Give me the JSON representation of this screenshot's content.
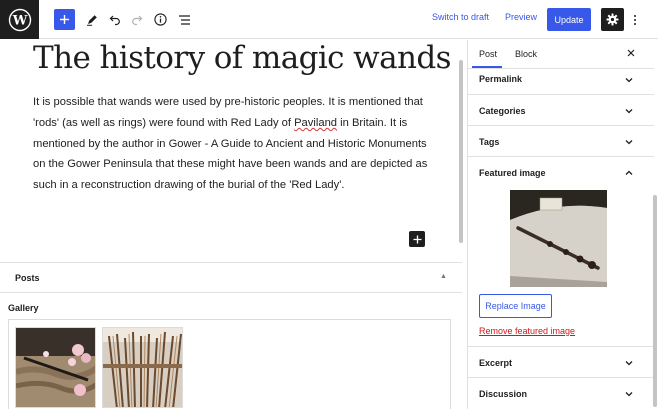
{
  "toolbar": {
    "switch_to_draft": "Switch to draft",
    "preview": "Preview",
    "update": "Update",
    "icons": [
      "wordpress-logo-icon",
      "plus-icon",
      "pencil-icon",
      "undo-icon",
      "redo-icon",
      "info-icon",
      "list-view-icon",
      "gear-icon",
      "more-vertical-icon"
    ],
    "accent": "#3858e9"
  },
  "editor": {
    "title": "The history of magic wands",
    "paragraph": {
      "part1": "It is possible that wands were used by pre-historic peoples. It is mentioned that 'rods' (as well as rings) were found with Red Lady of ",
      "squiggle": "Paviland",
      "part2": " in Britain. It is mentioned by the author in Gower - A Guide to Ancient and Historic Monuments on the Gower Peninsula that these might have been wands and are depicted as such in a reconstruction drawing of the burial of the 'Red Lady'."
    }
  },
  "meta": {
    "posts_title": "Posts",
    "posts_toggle": "▲",
    "gallery_label": "Gallery"
  },
  "sidebar": {
    "tabs": {
      "post": "Post",
      "block": "Block"
    },
    "close": "close-icon",
    "panels": {
      "permalink": "Permalink",
      "categories": "Categories",
      "tags": "Tags",
      "featured_image": "Featured image",
      "excerpt": "Excerpt",
      "discussion": "Discussion"
    },
    "replace_image": "Replace Image",
    "remove_featured_image": "Remove featured image",
    "danger_color": "#cc1818"
  }
}
